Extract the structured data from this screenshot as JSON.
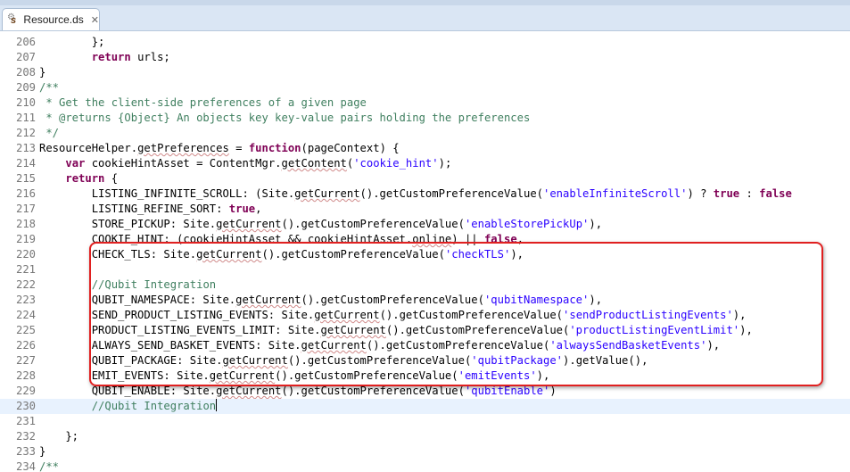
{
  "tab": {
    "title": "Resource.ds",
    "close_label": "✕"
  },
  "colors": {
    "keyword": "#7f0055",
    "string": "#2a00ff",
    "comment": "#3f7f5f",
    "highlight_border": "#e02020",
    "current_line": "#e8f2fe"
  },
  "editor": {
    "current_line_number": "230",
    "lines": [
      {
        "n": "206",
        "fold": "",
        "tokens": [
          {
            "t": "        };"
          }
        ]
      },
      {
        "n": "207",
        "fold": "",
        "tokens": [
          {
            "t": "        "
          },
          {
            "t": "return",
            "c": "kw"
          },
          {
            "t": " urls;"
          }
        ]
      },
      {
        "n": "208",
        "fold": "",
        "tokens": [
          {
            "t": "}"
          }
        ]
      },
      {
        "n": "209",
        "fold": "⊖",
        "tokens": [
          {
            "t": "/**",
            "c": "cmt"
          }
        ]
      },
      {
        "n": "210",
        "fold": "",
        "tokens": [
          {
            "t": " * Get the client-side preferences of a given page",
            "c": "cmt"
          }
        ]
      },
      {
        "n": "211",
        "fold": "",
        "tokens": [
          {
            "t": " * @returns {Object} An objects key key-value pairs holding the preferences",
            "c": "cmt"
          }
        ]
      },
      {
        "n": "212",
        "fold": "",
        "tokens": [
          {
            "t": " */",
            "c": "cmt"
          }
        ]
      },
      {
        "n": "213",
        "fold": "⊖",
        "tokens": [
          {
            "t": "ResourceHelper."
          },
          {
            "t": "getPreferences",
            "c": "squig"
          },
          {
            "t": " = "
          },
          {
            "t": "function",
            "c": "kw"
          },
          {
            "t": "(pageContext) {"
          }
        ]
      },
      {
        "n": "214",
        "fold": "",
        "tokens": [
          {
            "t": "    "
          },
          {
            "t": "var",
            "c": "kw"
          },
          {
            "t": " cookieHintAsset = ContentMgr."
          },
          {
            "t": "getContent",
            "c": "squig"
          },
          {
            "t": "("
          },
          {
            "t": "'cookie_hint'",
            "c": "str"
          },
          {
            "t": ");"
          }
        ]
      },
      {
        "n": "215",
        "fold": "",
        "tokens": [
          {
            "t": "    "
          },
          {
            "t": "return",
            "c": "kw"
          },
          {
            "t": " {"
          }
        ]
      },
      {
        "n": "216",
        "fold": "",
        "tokens": [
          {
            "t": "        LISTING_INFINITE_SCROLL: (Site."
          },
          {
            "t": "getCurrent",
            "c": "squig"
          },
          {
            "t": "().getCustomPreferenceValue("
          },
          {
            "t": "'enableInfiniteScroll'",
            "c": "str"
          },
          {
            "t": ") ? "
          },
          {
            "t": "true",
            "c": "kw"
          },
          {
            "t": " : "
          },
          {
            "t": "false",
            "c": "kw"
          }
        ]
      },
      {
        "n": "217",
        "fold": "",
        "tokens": [
          {
            "t": "        LISTING_REFINE_SORT: "
          },
          {
            "t": "true",
            "c": "kw"
          },
          {
            "t": ","
          }
        ]
      },
      {
        "n": "218",
        "fold": "",
        "tokens": [
          {
            "t": "        STORE_PICKUP: Site."
          },
          {
            "t": "getCurrent",
            "c": "squig"
          },
          {
            "t": "().getCustomPreferenceValue("
          },
          {
            "t": "'enableStorePickUp'",
            "c": "str"
          },
          {
            "t": "),"
          }
        ]
      },
      {
        "n": "219",
        "fold": "",
        "tokens": [
          {
            "t": "        COOKIE_HINT: (cookieHintAsset && cookieHintAsset."
          },
          {
            "t": "online",
            "c": "squig"
          },
          {
            "t": ") || "
          },
          {
            "t": "false",
            "c": "kw"
          },
          {
            "t": ","
          }
        ]
      },
      {
        "n": "220",
        "fold": "",
        "tokens": [
          {
            "t": "        CHECK_TLS: Site."
          },
          {
            "t": "getCurrent",
            "c": "squig"
          },
          {
            "t": "().getCustomPreferenceValue("
          },
          {
            "t": "'checkTLS'",
            "c": "str"
          },
          {
            "t": "),"
          }
        ]
      },
      {
        "n": "221",
        "fold": "",
        "tokens": [
          {
            "t": ""
          }
        ]
      },
      {
        "n": "222",
        "fold": "",
        "tokens": [
          {
            "t": "        "
          },
          {
            "t": "//Qubit Integration",
            "c": "cmt"
          }
        ]
      },
      {
        "n": "223",
        "fold": "",
        "tokens": [
          {
            "t": "        QUBIT_NAMESPACE: Site."
          },
          {
            "t": "getCurrent",
            "c": "squig"
          },
          {
            "t": "().getCustomPreferenceValue("
          },
          {
            "t": "'qubitNamespace'",
            "c": "str"
          },
          {
            "t": "),"
          }
        ]
      },
      {
        "n": "224",
        "fold": "",
        "tokens": [
          {
            "t": "        SEND_PRODUCT_LISTING_EVENTS: Site."
          },
          {
            "t": "getCurrent",
            "c": "squig"
          },
          {
            "t": "().getCustomPreferenceValue("
          },
          {
            "t": "'sendProductListingEvents'",
            "c": "str"
          },
          {
            "t": "),"
          }
        ]
      },
      {
        "n": "225",
        "fold": "",
        "tokens": [
          {
            "t": "        PRODUCT_LISTING_EVENTS_LIMIT: Site."
          },
          {
            "t": "getCurrent",
            "c": "squig"
          },
          {
            "t": "().getCustomPreferenceValue("
          },
          {
            "t": "'productListingEventLimit'",
            "c": "str"
          },
          {
            "t": "),"
          }
        ]
      },
      {
        "n": "226",
        "fold": "",
        "tokens": [
          {
            "t": "        ALWAYS_SEND_BASKET_EVENTS: Site."
          },
          {
            "t": "getCurrent",
            "c": "squig"
          },
          {
            "t": "().getCustomPreferenceValue("
          },
          {
            "t": "'alwaysSendBasketEvents'",
            "c": "str"
          },
          {
            "t": "),"
          }
        ]
      },
      {
        "n": "227",
        "fold": "",
        "tokens": [
          {
            "t": "        QUBIT_PACKAGE: Site."
          },
          {
            "t": "getCurrent",
            "c": "squig"
          },
          {
            "t": "().getCustomPreferenceValue("
          },
          {
            "t": "'qubitPackage'",
            "c": "str"
          },
          {
            "t": ").getValue(),"
          }
        ]
      },
      {
        "n": "228",
        "fold": "",
        "tokens": [
          {
            "t": "        EMIT_EVENTS: Site."
          },
          {
            "t": "getCurrent",
            "c": "squig"
          },
          {
            "t": "().getCustomPreferenceValue("
          },
          {
            "t": "'emitEvents'",
            "c": "str"
          },
          {
            "t": "),"
          }
        ]
      },
      {
        "n": "229",
        "fold": "",
        "tokens": [
          {
            "t": "        QUBIT_ENABLE: Site."
          },
          {
            "t": "getCurrent",
            "c": "squig"
          },
          {
            "t": "().getCustomPreferenceValue("
          },
          {
            "t": "'qubitEnable'",
            "c": "str"
          },
          {
            "t": ")"
          }
        ]
      },
      {
        "n": "230",
        "fold": "",
        "tokens": [
          {
            "t": "        "
          },
          {
            "t": "//Qubit Integration",
            "c": "cmt"
          }
        ]
      },
      {
        "n": "231",
        "fold": "",
        "tokens": [
          {
            "t": ""
          }
        ]
      },
      {
        "n": "232",
        "fold": "",
        "tokens": [
          {
            "t": "    };"
          }
        ]
      },
      {
        "n": "233",
        "fold": "",
        "tokens": [
          {
            "t": "}"
          }
        ]
      },
      {
        "n": "234",
        "fold": "⊖",
        "tokens": [
          {
            "t": "/**",
            "c": "cmt"
          }
        ]
      }
    ]
  }
}
